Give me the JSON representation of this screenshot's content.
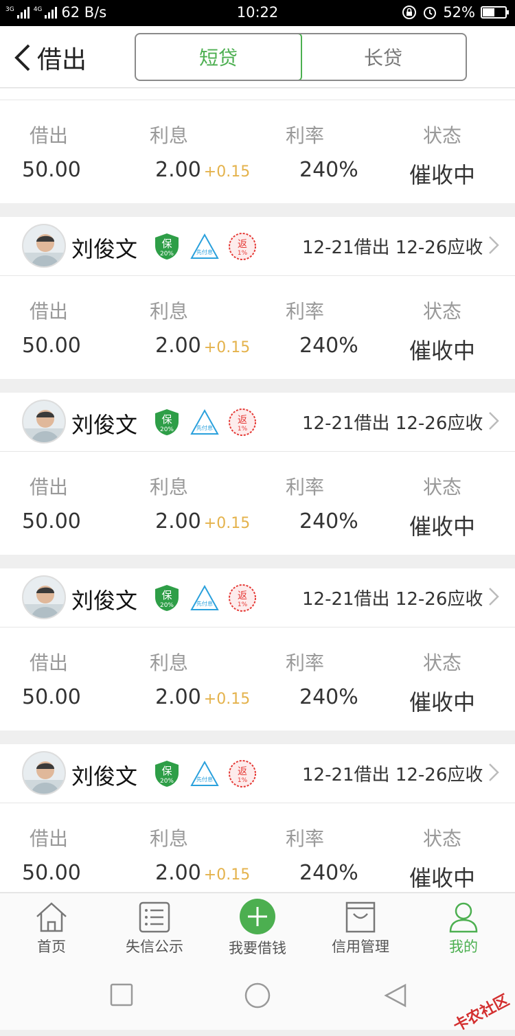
{
  "status": {
    "network_left": "3G",
    "network_right": "4G",
    "speed": "62 B/s",
    "time": "10:22",
    "battery": "52%",
    "battery_level": 0.52
  },
  "header": {
    "back_label": "借出",
    "tabs": [
      "短贷",
      "长贷"
    ],
    "active_tab": 0
  },
  "labels": {
    "lent": "借出",
    "interest": "利息",
    "rate": "利率",
    "status": "状态"
  },
  "first_row": {
    "amount": "50.00",
    "interest": "2.00",
    "extra": "+0.15",
    "rate": "240%",
    "status": "催收中"
  },
  "records": [
    {
      "name": "刘俊文",
      "badge_bao": "保",
      "badge_bao_sub": "20%",
      "badge_xian": "先付息",
      "badge_fan": "返",
      "badge_fan_sub": "1%",
      "dates": "12-21借出 12-26应收",
      "amount": "50.00",
      "interest": "2.00",
      "extra": "+0.15",
      "rate": "240%",
      "status": "催收中"
    },
    {
      "name": "刘俊文",
      "badge_bao": "保",
      "badge_bao_sub": "20%",
      "badge_xian": "先付息",
      "badge_fan": "返",
      "badge_fan_sub": "1%",
      "dates": "12-21借出 12-26应收",
      "amount": "50.00",
      "interest": "2.00",
      "extra": "+0.15",
      "rate": "240%",
      "status": "催收中"
    },
    {
      "name": "刘俊文",
      "badge_bao": "保",
      "badge_bao_sub": "20%",
      "badge_xian": "先付息",
      "badge_fan": "返",
      "badge_fan_sub": "1%",
      "dates": "12-21借出 12-26应收",
      "amount": "50.00",
      "interest": "2.00",
      "extra": "+0.15",
      "rate": "240%",
      "status": "催收中"
    },
    {
      "name": "刘俊文",
      "badge_bao": "保",
      "badge_bao_sub": "20%",
      "badge_xian": "先付息",
      "badge_fan": "返",
      "badge_fan_sub": "1%",
      "dates": "12-21借出 12-26应收",
      "amount": "50.00",
      "interest": "2.00",
      "extra": "+0.15",
      "rate": "240%",
      "status": "催收中"
    }
  ],
  "tabbar": {
    "items": [
      {
        "label": "首页",
        "icon": "home-icon"
      },
      {
        "label": "失信公示",
        "icon": "list-icon"
      },
      {
        "label": "我要借钱",
        "icon": "plus-circle-icon"
      },
      {
        "label": "信用管理",
        "icon": "bag-icon"
      },
      {
        "label": "我的",
        "icon": "user-icon"
      }
    ],
    "active": 4
  },
  "watermark": "卡农社区",
  "colors": {
    "accent": "#4caf50",
    "extra": "#e4b24b",
    "badge_fan": "#e53935",
    "badge_xian": "#29a0dc"
  }
}
